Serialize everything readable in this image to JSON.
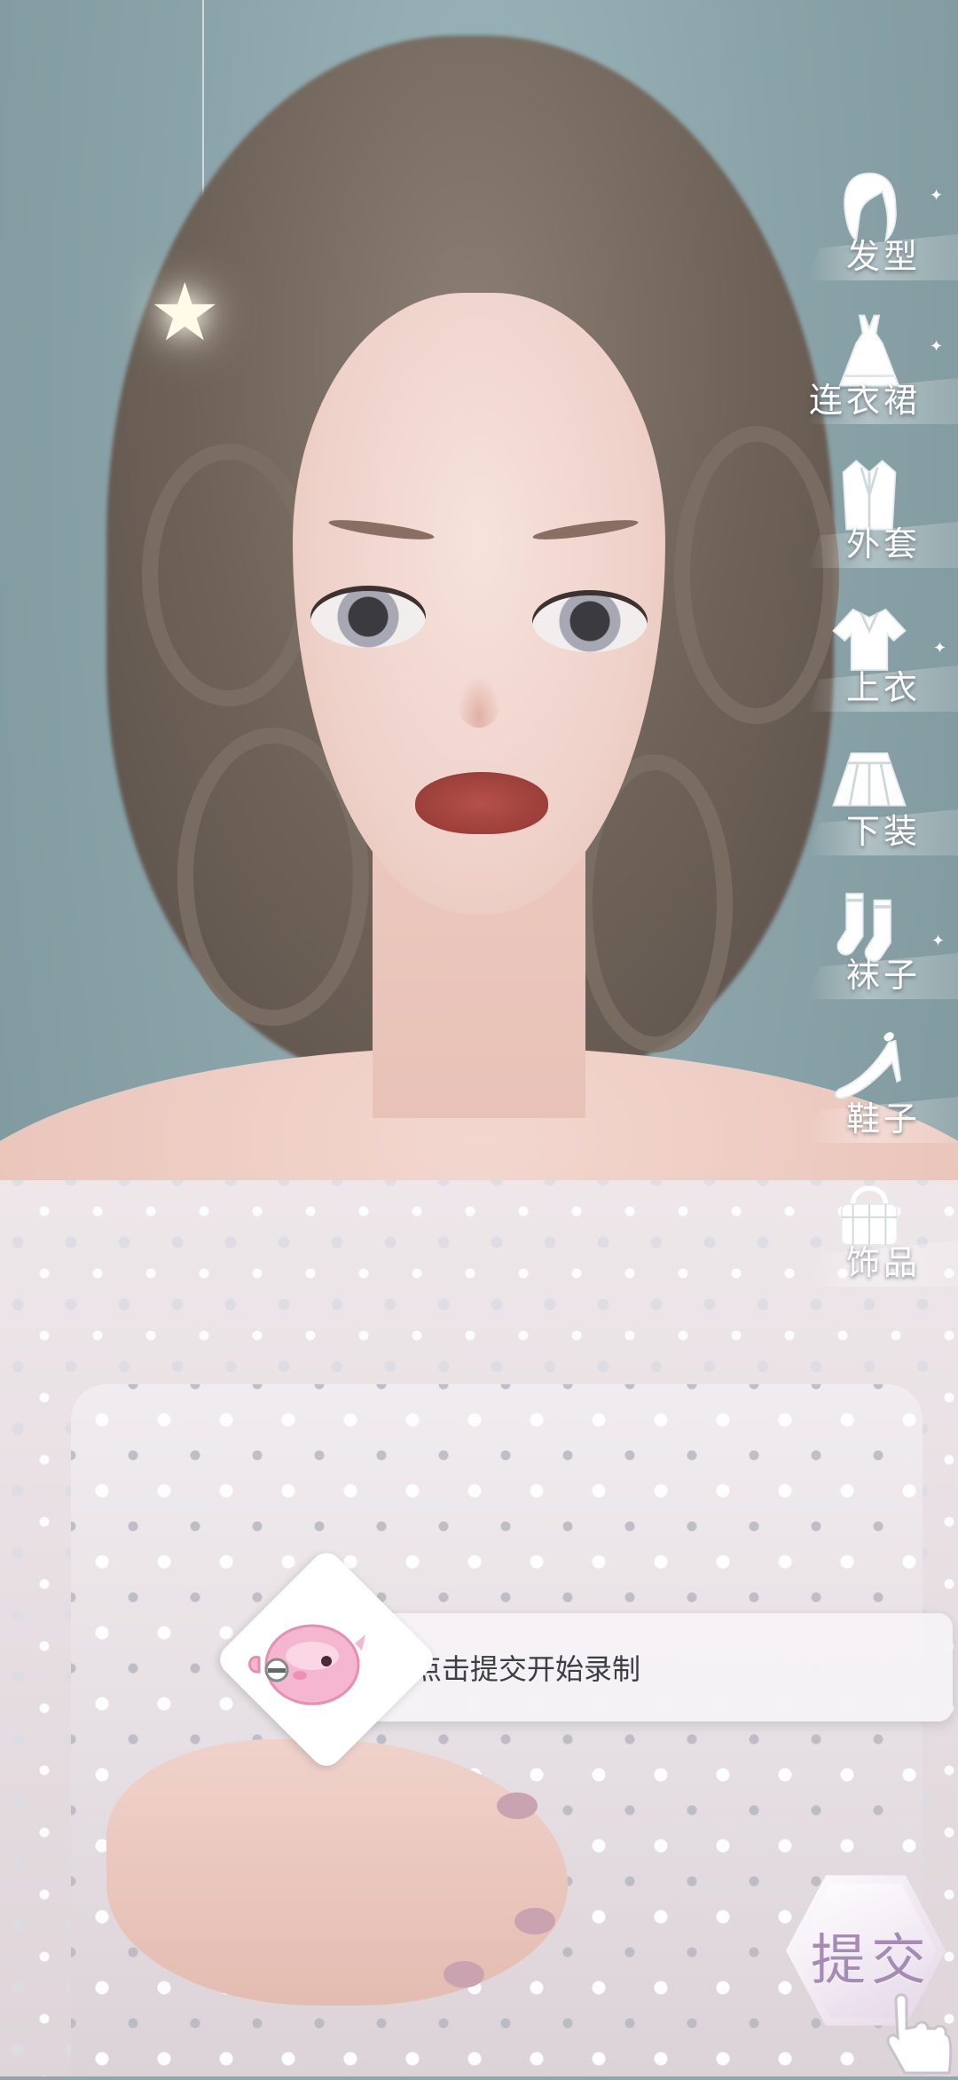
{
  "categories": [
    {
      "key": "hair",
      "label": "发型",
      "icon": "hair-icon"
    },
    {
      "key": "dress",
      "label": "连衣裙",
      "icon": "dress-icon"
    },
    {
      "key": "coat",
      "label": "外套",
      "icon": "coat-icon"
    },
    {
      "key": "top",
      "label": "上衣",
      "icon": "top-icon"
    },
    {
      "key": "bottom",
      "label": "下装",
      "icon": "skirt-icon"
    },
    {
      "key": "socks",
      "label": "袜子",
      "icon": "socks-icon"
    },
    {
      "key": "shoes",
      "label": "鞋子",
      "icon": "high-heel-icon"
    },
    {
      "key": "accessory",
      "label": "饰品",
      "icon": "handbag-icon"
    }
  ],
  "hint": {
    "text": "点击提交开始录制",
    "mascot": "pink-mascot-icon"
  },
  "submit": {
    "label": "提交",
    "pointer": "pointer-hand-icon"
  }
}
